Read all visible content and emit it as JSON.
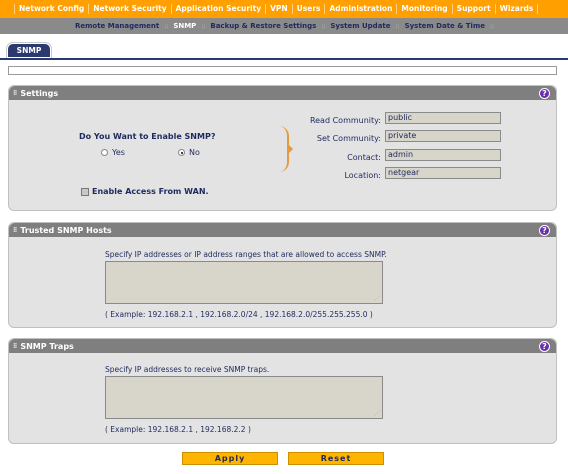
{
  "topnav": {
    "items": [
      "Network Config",
      "Network Security",
      "Application Security",
      "VPN",
      "Users",
      "Administration",
      "Monitoring",
      "Support",
      "Wizards"
    ],
    "active": "Administration"
  },
  "subnav": {
    "items": [
      "Remote Management",
      "SNMP",
      "Backup & Restore Settings",
      "System Update",
      "System Date & Time"
    ],
    "active": "SNMP"
  },
  "tab": {
    "label": "SNMP"
  },
  "settings": {
    "title": "Settings",
    "question": "Do You Want to Enable SNMP?",
    "yes_label": "Yes",
    "no_label": "No",
    "selected": "No",
    "read_community_label": "Read Community:",
    "read_community_value": "public",
    "set_community_label": "Set Community:",
    "set_community_value": "private",
    "contact_label": "Contact:",
    "contact_value": "admin",
    "location_label": "Location:",
    "location_value": "netgear",
    "wan_label": "Enable Access From WAN."
  },
  "trusted": {
    "title": "Trusted SNMP Hosts",
    "description": "Specify IP addresses or IP address ranges that are allowed to access SNMP.",
    "example": "( Example: 192.168.2.1 , 192.168.2.0/24 , 192.168.2.0/255.255.255.0 )"
  },
  "traps": {
    "title": "SNMP Traps",
    "description": "Specify IP addresses to receive SNMP traps.",
    "example": "( Example: 192.168.2.1 , 192.168.2.2 )"
  },
  "buttons": {
    "apply": "Apply",
    "reset": "Reset"
  },
  "help_glyph": "?",
  "colors": {
    "nav_orange": "#ff9f00",
    "tab_navy": "#2a3a6e",
    "button_yellow": "#ffb400",
    "help_purple": "#6a2fb0"
  }
}
